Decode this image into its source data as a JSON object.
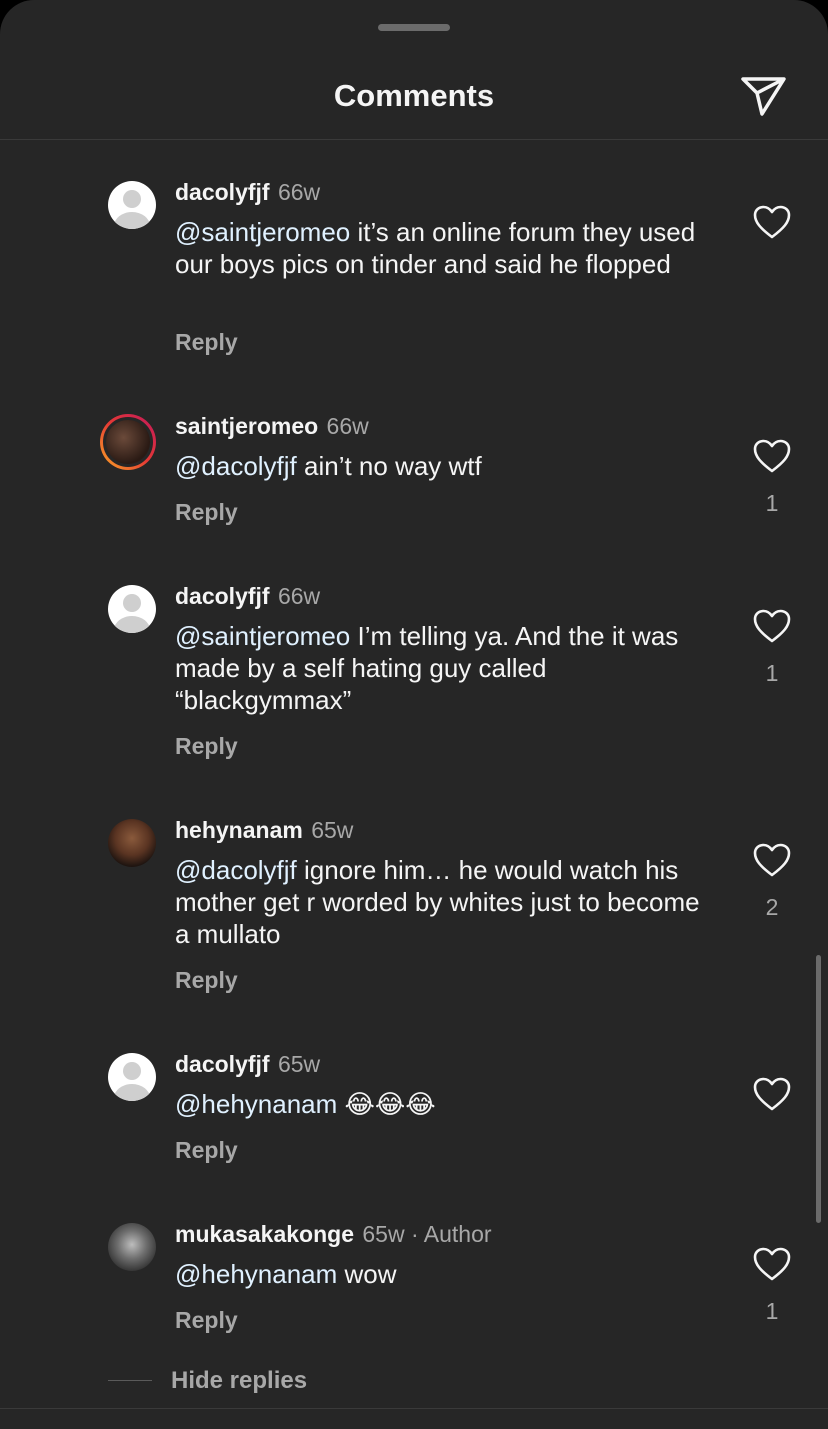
{
  "header": {
    "title": "Comments",
    "share_icon": "paper-plane-icon"
  },
  "comments": [
    {
      "username": "dacolyfjf",
      "time": "66w",
      "mention": "@saintjeromeo",
      "text": " it’s an online forum they used our boys pics on tinder and said he flopped",
      "reply": "Reply",
      "likes": ""
    },
    {
      "username": "saintjeromeo",
      "time": "66w",
      "mention": "@dacolyfjf",
      "text": " ain’t no way wtf",
      "reply": "Reply",
      "likes": "1"
    },
    {
      "username": "dacolyfjf",
      "time": "66w",
      "mention": "@saintjeromeo",
      "text": " I’m telling ya. And the it was made by a self hating guy called “blackgymmax”",
      "reply": "Reply",
      "likes": "1"
    },
    {
      "username": "hehynanam",
      "time": "65w",
      "mention": "@dacolyfjf",
      "text": " ignore him… he would watch his mother get r worded by whites just to become a mullato",
      "reply": "Reply",
      "likes": "2"
    },
    {
      "username": "dacolyfjf",
      "time": "65w",
      "mention": "@hehynanam",
      "text": " 😂😂😂",
      "reply": "Reply",
      "likes": ""
    },
    {
      "username": "mukasakakonge",
      "time": "65w",
      "author_tag": " · Author",
      "mention": "@hehynanam",
      "text": " wow",
      "reply": "Reply",
      "likes": "1"
    }
  ],
  "hide_replies": "Hide replies"
}
